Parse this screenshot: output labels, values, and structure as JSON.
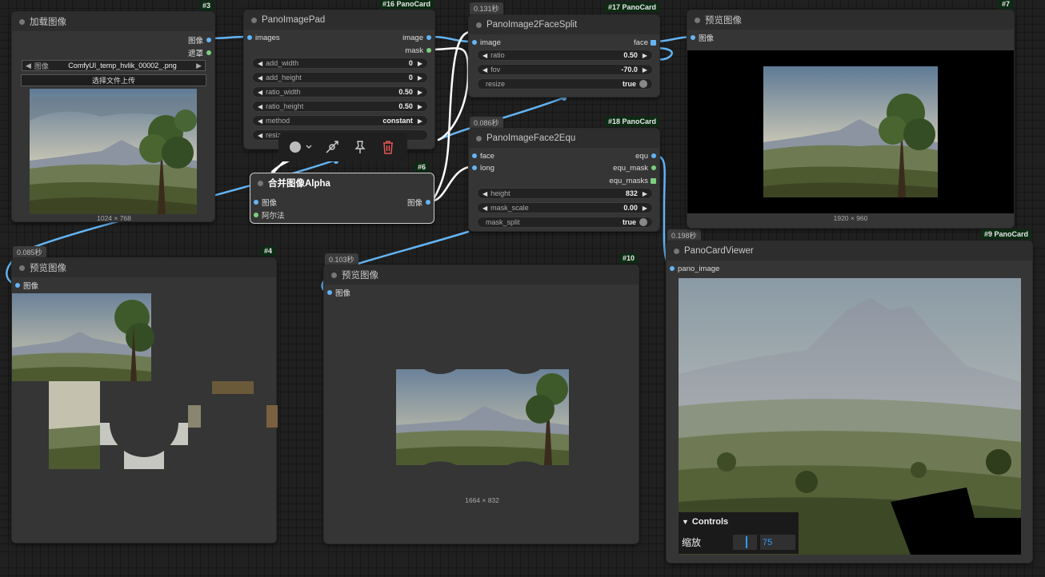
{
  "nodes": {
    "load_image": {
      "id": "#3",
      "title": "加载图像",
      "outputs": [
        "图像",
        "遮罩"
      ],
      "combo_label": "图像",
      "combo_value": "ComfyUI_temp_hvlik_00002_.png",
      "upload_label": "选择文件上传",
      "caption": "1024 × 768"
    },
    "pad": {
      "id": "#16 PanoCard",
      "title": "PanoImagePad",
      "input": "images",
      "outputs": [
        "image",
        "mask"
      ],
      "widgets": [
        {
          "label": "add_width",
          "value": "0"
        },
        {
          "label": "add_height",
          "value": "0"
        },
        {
          "label": "ratio_width",
          "value": "0.50"
        },
        {
          "label": "ratio_height",
          "value": "0.50"
        },
        {
          "label": "method",
          "value": "constant"
        },
        {
          "label": "resiz",
          "value": ""
        }
      ]
    },
    "face_split": {
      "id": "#17 PanoCard",
      "timing": "0.131秒",
      "title": "PanoImage2FaceSplit",
      "input": "image",
      "output": "face",
      "widgets": [
        {
          "label": "ratio",
          "value": "0.50"
        },
        {
          "label": "fov",
          "value": "-70.0"
        },
        {
          "label": "resize",
          "value": "true"
        }
      ]
    },
    "preview7": {
      "id": "#7",
      "title": "预览图像",
      "input": "图像",
      "caption": "1920 × 960"
    },
    "merge_alpha": {
      "id": "#6",
      "title": "合并图像Alpha",
      "inputs": [
        "图像",
        "阿尔法"
      ],
      "output": "图像"
    },
    "face2equ": {
      "id": "#18 PanoCard",
      "timing": "0.086秒",
      "title": "PanoImageFace2Equ",
      "inputs": [
        "face",
        "long"
      ],
      "outputs": [
        "equ",
        "equ_mask",
        "equ_masks"
      ],
      "widgets": [
        {
          "label": "height",
          "value": "832"
        },
        {
          "label": "mask_scale",
          "value": "0.00"
        },
        {
          "label": "mask_split",
          "value": "true"
        }
      ]
    },
    "preview4": {
      "id": "#4",
      "timing": "0.085秒",
      "title": "预览图像",
      "input": "图像"
    },
    "preview10": {
      "id": "#10",
      "timing": "0.103秒",
      "title": "预览图像",
      "input": "图像",
      "caption": "1664 × 832"
    },
    "viewer": {
      "id": "#9 PanoCard",
      "timing": "0.198秒",
      "title": "PanoCardViewer",
      "input": "pano_image",
      "controls_title": "Controls",
      "zoom_label": "缩放",
      "zoom_value": "75"
    }
  },
  "toolbar_icons": [
    "color-circle-icon",
    "chevron-down-icon",
    "bypass-link-icon",
    "pin-icon",
    "trash-icon"
  ],
  "colors": {
    "link": "#64b5f6",
    "white_link": "#ffffff",
    "badge_bg": "#0b2b12",
    "delete": "#e05555"
  }
}
